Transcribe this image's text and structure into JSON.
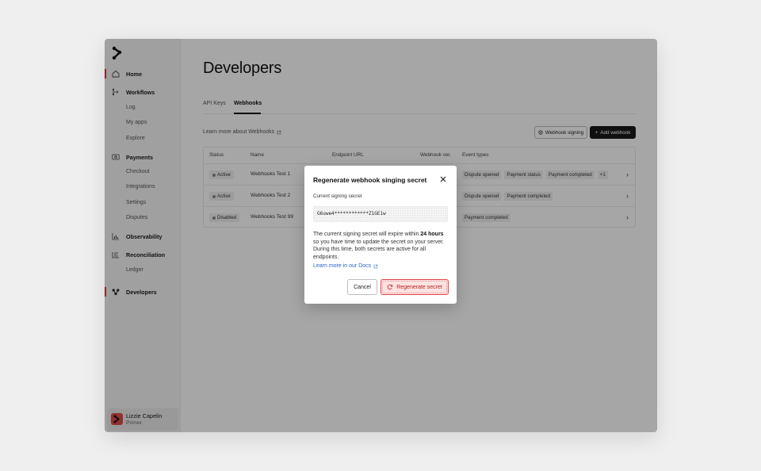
{
  "sidebar": {
    "items": [
      {
        "label": "Home",
        "icon": "home-icon"
      },
      {
        "label": "Workflows",
        "icon": "workflow-icon"
      },
      {
        "label": "Payments",
        "icon": "payments-icon"
      },
      {
        "label": "Observability",
        "icon": "chart-icon"
      },
      {
        "label": "Reconciliation",
        "icon": "reconcile-icon"
      },
      {
        "label": "Developers",
        "icon": "developers-icon"
      }
    ],
    "workflows_sub": [
      "Log",
      "My apps",
      "Explore"
    ],
    "payments_sub": [
      "Checkout",
      "Integrations",
      "Settings",
      "Disputes"
    ],
    "reconciliation_sub": [
      "Ledger"
    ],
    "active_accent": "#e23838"
  },
  "user": {
    "name": "Lizzie Capelin",
    "org": "Primer"
  },
  "page": {
    "title": "Developers",
    "tabs": [
      {
        "label": "API Keys"
      },
      {
        "label": "Webhooks"
      }
    ],
    "learn_more": "Learn more about Webhooks",
    "webhook_signing": "Webhook signing",
    "add_webhook": "Add webhook"
  },
  "table": {
    "headers": [
      "Status",
      "Name",
      "Endpoint URL",
      "Webhook ver.",
      "Event types"
    ],
    "rows": [
      {
        "status": "Active",
        "name": "Webhooks Test 1",
        "events": [
          "Dispute opened",
          "Payment status",
          "Payment completed",
          "+1"
        ]
      },
      {
        "status": "Active",
        "name": "Webhooks Test 2",
        "events": [
          "Dispute opened",
          "Payment completed"
        ]
      },
      {
        "status": "Disabled",
        "name": "Webhooks Test 99",
        "events": [
          "Payment completed"
        ]
      }
    ]
  },
  "modal": {
    "title": "Regenerate webhook singing secret",
    "label": "Current signing secret",
    "secret": "G6uwe4************Z1GE1w",
    "text_before": "The current signing secret will expire within ",
    "text_bold": "24 hours",
    "text_after": " so you have time to update the secret on your server. During this time, both secrets are active for all endpoints.",
    "doc_link": "Learn more in our Docs",
    "cancel": "Cancel",
    "regenerate": "Regenerate secret",
    "accent": "#e24848"
  }
}
